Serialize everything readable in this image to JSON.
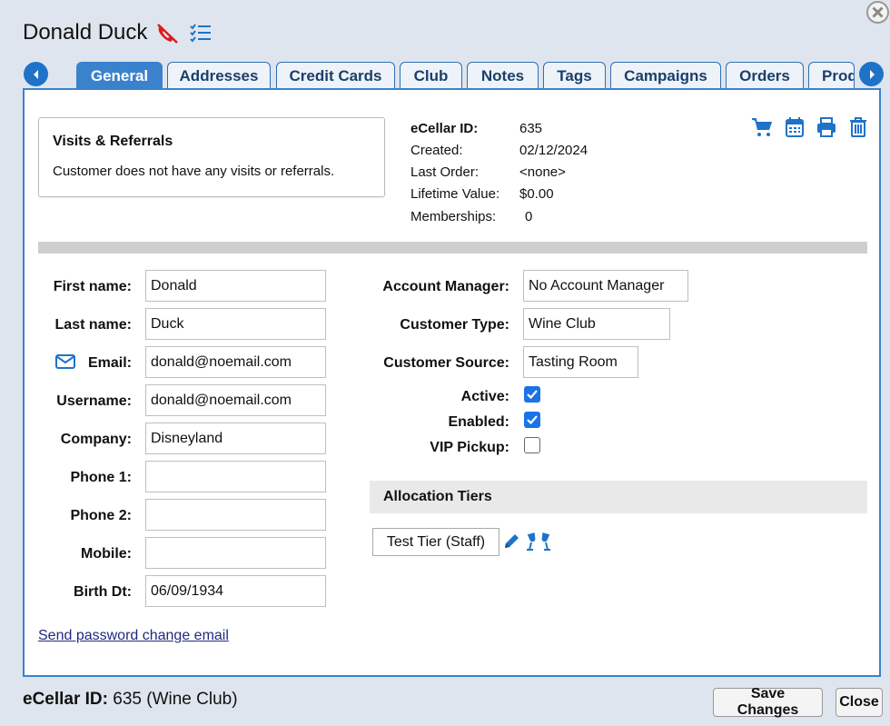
{
  "header": {
    "customer_name": "Donald Duck",
    "icons": [
      "no-phone-icon",
      "checklist-icon",
      "close-circle-icon"
    ]
  },
  "tabs": [
    {
      "label": "General",
      "active": true
    },
    {
      "label": "Addresses"
    },
    {
      "label": "Credit Cards"
    },
    {
      "label": "Club"
    },
    {
      "label": "Notes"
    },
    {
      "label": "Tags"
    },
    {
      "label": "Campaigns"
    },
    {
      "label": "Orders"
    },
    {
      "label": "Produ"
    }
  ],
  "visits": {
    "title": "Visits & Referrals",
    "text": "Customer does not have any visits or referrals."
  },
  "info": {
    "ecellar_id_label": "eCellar ID:",
    "ecellar_id": "635",
    "created_label": "Created:",
    "created": "02/12/2024",
    "last_order_label": "Last Order:",
    "last_order": "<none>",
    "lifetime_value_label": "Lifetime Value:",
    "lifetime_value": "$0.00",
    "memberships_label": "Memberships:",
    "memberships": "0"
  },
  "toolbar_icons": [
    "cart-icon",
    "calendar-icon",
    "print-icon",
    "trash-icon"
  ],
  "left_fields": {
    "first_name_label": "First name:",
    "first_name": "Donald",
    "last_name_label": "Last name:",
    "last_name": "Duck",
    "email_label": "Email:",
    "email": "donald@noemail.com",
    "username_label": "Username:",
    "username": "donald@noemail.com",
    "company_label": "Company:",
    "company": "Disneyland",
    "phone1_label": "Phone 1:",
    "phone1": "",
    "phone2_label": "Phone 2:",
    "phone2": "",
    "mobile_label": "Mobile:",
    "mobile": "",
    "birth_label": "Birth Dt:",
    "birth": "06/09/1934"
  },
  "right_fields": {
    "account_manager_label": "Account Manager:",
    "account_manager": "No Account Manager",
    "customer_type_label": "Customer Type:",
    "customer_type": "Wine Club",
    "customer_source_label": "Customer Source:",
    "customer_source": "Tasting Room",
    "active_label": "Active:",
    "active": true,
    "enabled_label": "Enabled:",
    "enabled": true,
    "vip_label": "VIP Pickup:",
    "vip": false
  },
  "allocation": {
    "title": "Allocation Tiers",
    "tiers": [
      "Test Tier (Staff)"
    ]
  },
  "links": {
    "password_email": "Send password change email"
  },
  "footer": {
    "id_label": "eCellar ID:",
    "id_text": "635 (Wine Club)",
    "save_label": "Save Changes",
    "close_label": "Close"
  },
  "colors": {
    "accent": "#3b82cc",
    "icon_blue": "#1e73c8",
    "alert_red": "#e01b1b"
  }
}
